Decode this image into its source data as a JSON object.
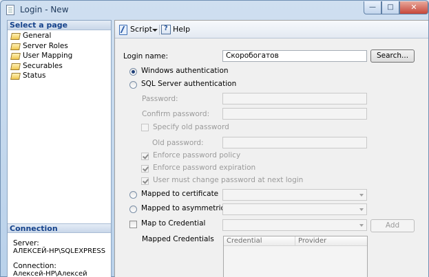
{
  "window": {
    "title": "Login - New",
    "minimize": "—",
    "maximize": "□",
    "close": "✕"
  },
  "left_panel": {
    "select_page_header": "Select a page",
    "pages": [
      {
        "label": "General",
        "icon": "page-icon"
      },
      {
        "label": "Server Roles",
        "icon": "page-icon"
      },
      {
        "label": "User Mapping",
        "icon": "page-icon"
      },
      {
        "label": "Securables",
        "icon": "page-icon"
      },
      {
        "label": "Status",
        "icon": "page-icon"
      }
    ],
    "connection_header": "Connection",
    "server_label": "Server:",
    "server_value": "АЛЕКСЕЙ-НР\\SQLEXPRESS",
    "connection_label": "Connection:",
    "connection_value": "Алексей-НР\\Алексей"
  },
  "toolbar": {
    "script_label": "Script",
    "help_label": "Help"
  },
  "form": {
    "login_name_label": "Login name:",
    "login_name_value": "Скоробогатов",
    "search_button": "Search...",
    "windows_auth_label": "Windows authentication",
    "windows_auth_selected": true,
    "sql_auth_label": "SQL Server authentication",
    "password_label": "Password:",
    "confirm_password_label": "Confirm password:",
    "specify_old_password_label": "Specify old password",
    "old_password_label": "Old password:",
    "enforce_policy_label": "Enforce password policy",
    "enforce_expiration_label": "Enforce password expiration",
    "must_change_label": "User must change password at next login",
    "mapped_cert_label": "Mapped to certificate",
    "mapped_asym_label": "Mapped to asymmetric key",
    "map_credential_label": "Map to Credential",
    "add_button": "Add",
    "mapped_credentials_label": "Mapped Credentials",
    "grid_columns": [
      "Credential",
      "Provider"
    ]
  }
}
